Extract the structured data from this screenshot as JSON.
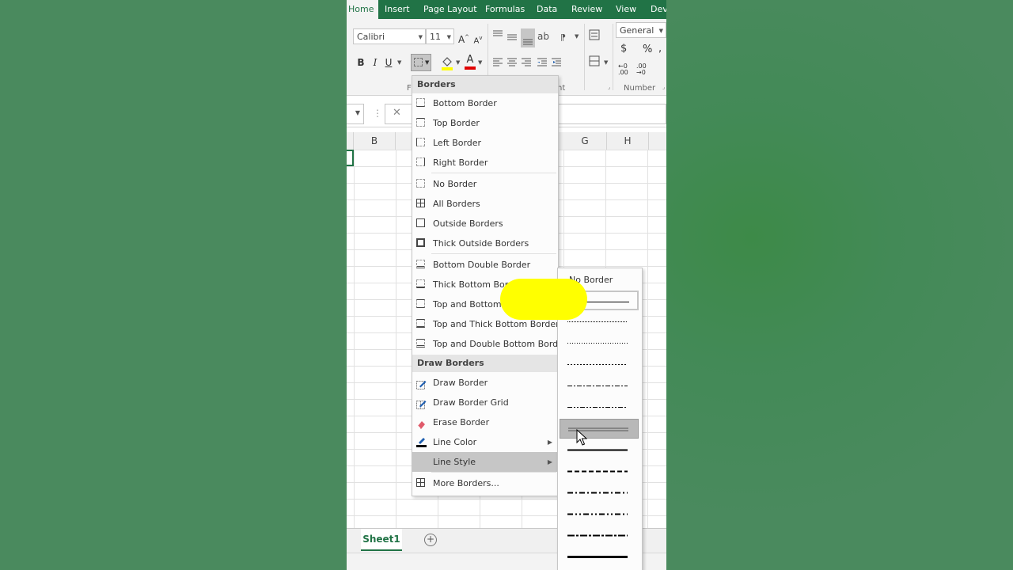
{
  "ribbon": {
    "tabs": [
      "Home",
      "Insert",
      "Page Layout",
      "Formulas",
      "Data",
      "Review",
      "View",
      "Deve"
    ],
    "font_name": "Calibri",
    "font_size": "11",
    "number_format": "General",
    "group_font": "F",
    "group_alignment": "nt",
    "group_number": "Number",
    "currency_symbol": "$",
    "percent_symbol": "%",
    "comma_symbol": ",",
    "increase_decimal": "←0 .00",
    "decrease_decimal": ".00 →0",
    "bold": "B",
    "italic": "I",
    "underline": "U",
    "grow_font": "A",
    "shrink_font": "A",
    "font_color_letter": "A",
    "accent_color": "#217346",
    "fill_color": "#ffff00",
    "font_color": "#e00000"
  },
  "formula_bar": {
    "cancel": "✕",
    "more": "⋮"
  },
  "columns": [
    "B",
    "G",
    "H"
  ],
  "sheet_tab": "Sheet1",
  "add_sheet": "+",
  "borders_menu": {
    "header_borders": "Borders",
    "group1": [
      "Bottom Border",
      "Top Border",
      "Left Border",
      "Right Border"
    ],
    "group2": [
      "No Border",
      "All Borders",
      "Outside Borders",
      "Thick Outside Borders"
    ],
    "group3": [
      "Bottom Double Border",
      "Thick Bottom Border",
      "Top and Bottom Border",
      "Top and Thick Bottom Border",
      "Top and Double Bottom Border"
    ],
    "header_draw": "Draw Borders",
    "draw_items": [
      "Draw Border",
      "Draw Border Grid",
      "Erase Border",
      "Line Color",
      "Line Style"
    ],
    "more_borders": "More Borders..."
  },
  "line_style_menu": {
    "no_border": "No Border",
    "styles": [
      "thin",
      "hair",
      "dotted",
      "dashed-fine",
      "dash-dot-fine",
      "dash-dot-dot-fine",
      "double",
      "medium",
      "medium-dashed",
      "medium-dash-dot",
      "medium-dash-dot-dot",
      "slant-dash-dot",
      "thick"
    ],
    "hovered_index": 6
  },
  "annotation_color": "#ffff00"
}
